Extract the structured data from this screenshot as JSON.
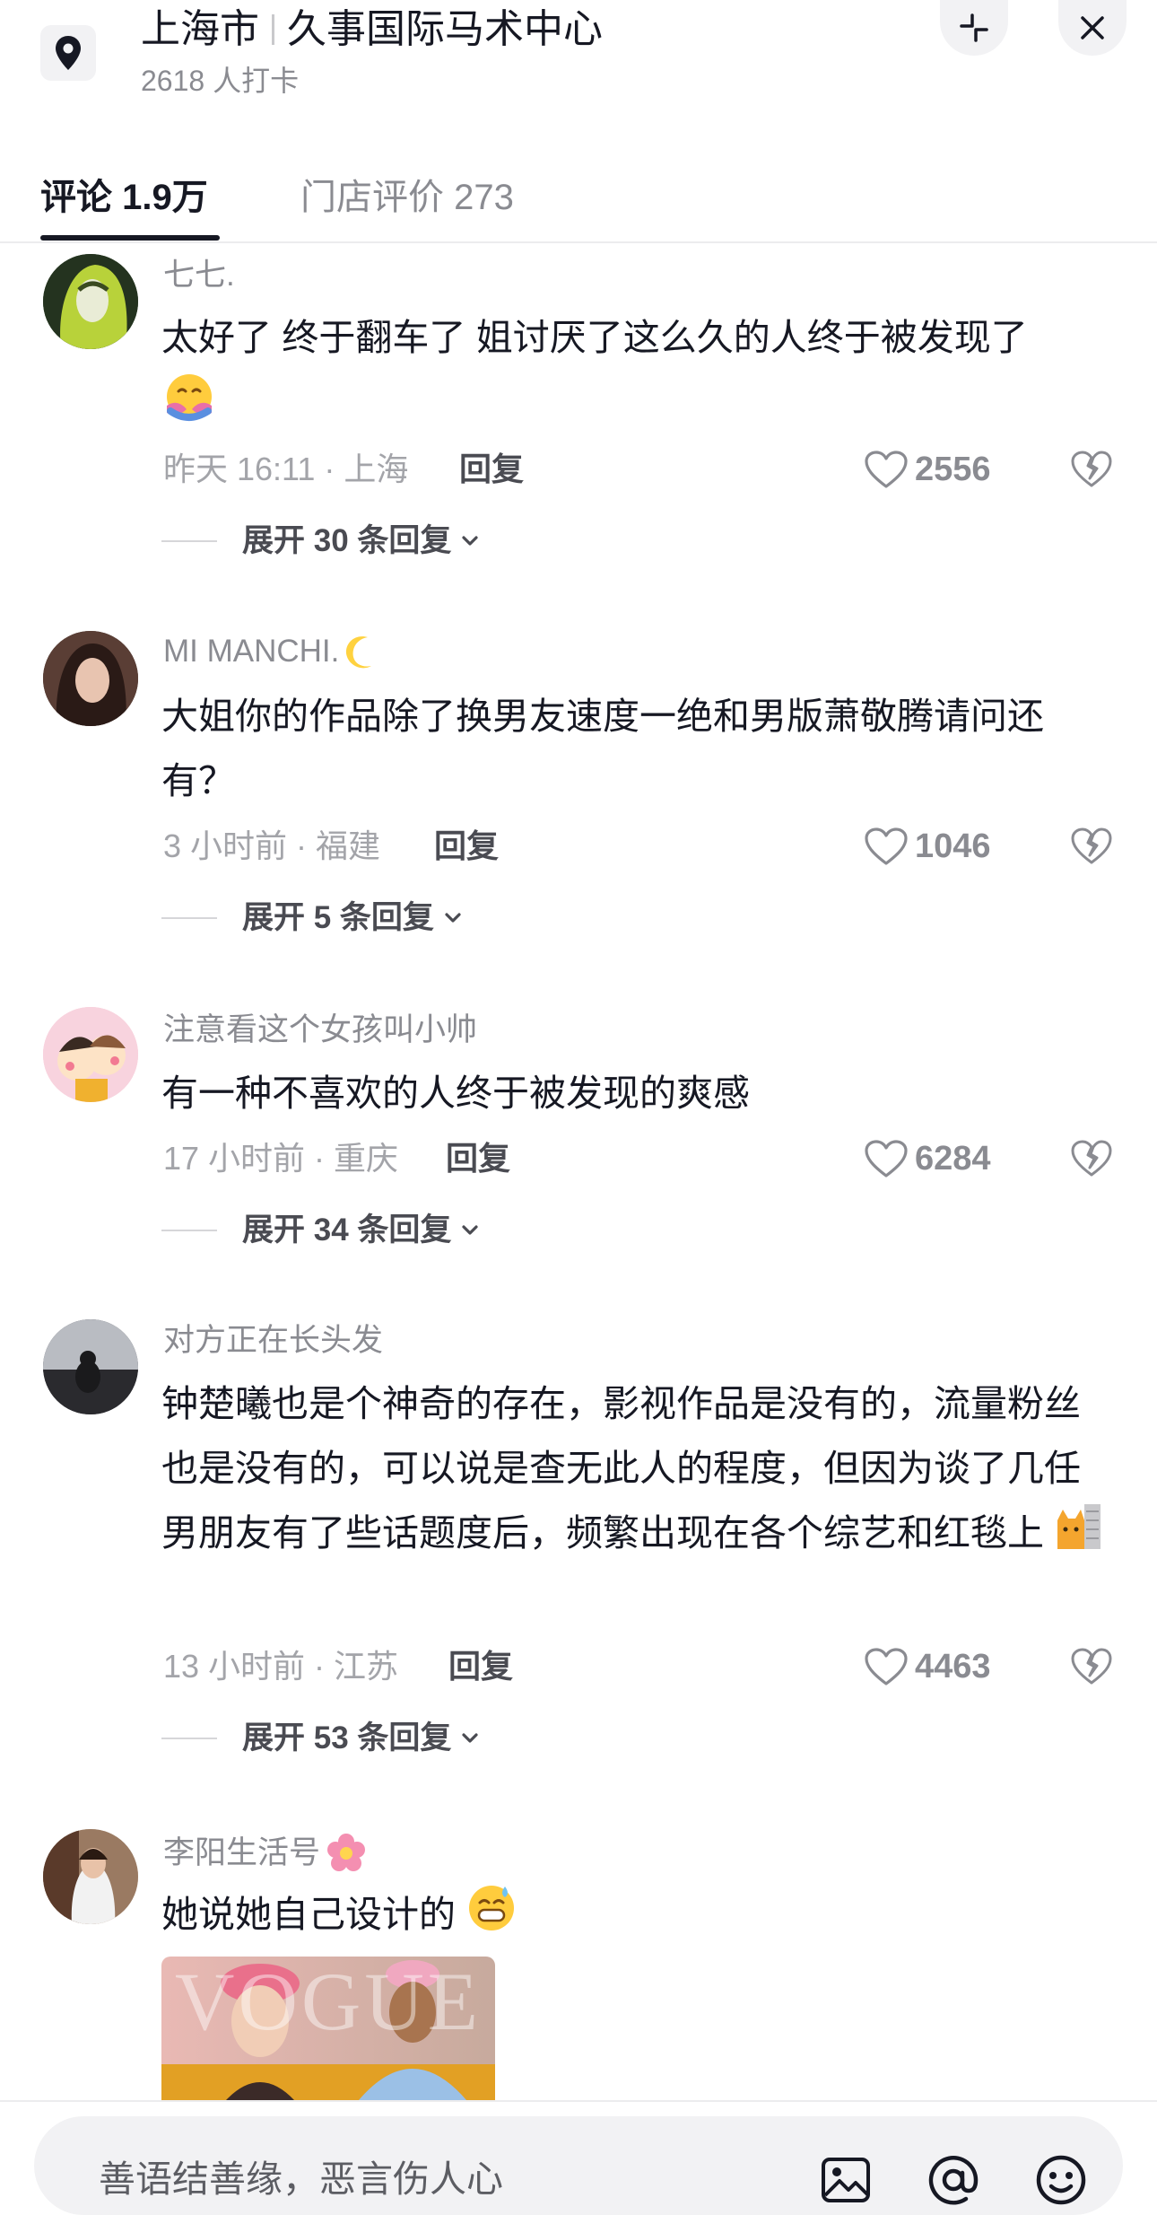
{
  "header": {
    "city": "上海市",
    "place": "久事国际马术中心",
    "checkins": "2618 人打卡",
    "icons": [
      "location-pin-icon",
      "collapse-icon",
      "close-icon"
    ]
  },
  "tabs": [
    {
      "label": "评论 1.9万",
      "active": true
    },
    {
      "label": "门店评价 273",
      "active": false
    }
  ],
  "comments": [
    {
      "username": "七七.",
      "text": "太好了 终于翻车了 姐讨厌了这么久的人终于被发现了",
      "emoji": "hug-emoji",
      "time_location": "昨天 16:11 · 上海",
      "reply_label": "回复",
      "likes": "2556",
      "expand_label": "展开 30 条回复"
    },
    {
      "username": "MI MANCHI.",
      "username_emoji": "moon-emoji",
      "text": "大姐你的作品除了换男友速度一绝和男版萧敬腾请问还有？",
      "time_location": "3 小时前 · 福建",
      "reply_label": "回复",
      "likes": "1046",
      "expand_label": "展开 5 条回复"
    },
    {
      "username": "注意看这个女孩叫小帅",
      "text": "有一种不喜欢的人终于被发现的爽感",
      "time_location": "17 小时前 · 重庆",
      "reply_label": "回复",
      "likes": "6284",
      "expand_label": "展开 34 条回复"
    },
    {
      "username": "对方正在长头发",
      "text": "钟楚曦也是个神奇的存在，影视作品是没有的，流量粉丝也是没有的，可以说是查无此人的程度，但因为谈了几任男朋友有了些话题度后，频繁出现在各个综艺和红毯上",
      "emoji": "cat-peek-emoji",
      "time_location": "13 小时前 · 江苏",
      "reply_label": "回复",
      "likes": "4463",
      "expand_label": "展开 53 条回复"
    },
    {
      "username": "李阳生活号",
      "username_emoji": "flower-emoji",
      "text": "她说她自己设计的",
      "emoji": "grin-sweat-emoji",
      "image_text": "VOGUE"
    }
  ],
  "input": {
    "placeholder": "善语结善缘，恶言伤人心",
    "icons": [
      "image-icon",
      "at-icon",
      "emoji-face-icon"
    ]
  },
  "colors": {
    "text_primary": "#161823",
    "text_secondary": "#8a8b91",
    "background": "#ffffff",
    "pill_background": "#f2f2f4"
  }
}
